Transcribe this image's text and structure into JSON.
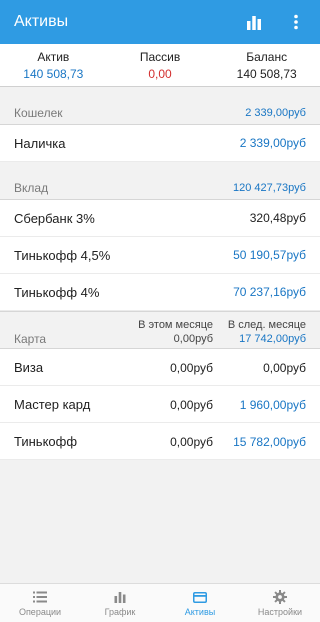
{
  "appbar": {
    "title": "Активы",
    "chart_icon": "bar-chart-icon",
    "menu_icon": "more-vertical-icon"
  },
  "summary": {
    "active": {
      "label": "Актив",
      "value": "140 508,73"
    },
    "passive": {
      "label": "Пассив",
      "value": "0,00"
    },
    "balance": {
      "label": "Баланс",
      "value": "140 508,73"
    }
  },
  "wallet": {
    "name": "Кошелек",
    "total": "2 339,00руб",
    "items": [
      {
        "name": "Наличка",
        "value": "2 339,00руб"
      }
    ]
  },
  "deposit": {
    "name": "Вклад",
    "total": "120 427,73руб",
    "items": [
      {
        "name": "Сбербанк 3%",
        "value": "320,48руб"
      },
      {
        "name": "Тинькофф 4,5%",
        "value": "50 190,57руб"
      },
      {
        "name": "Тинькофф 4%",
        "value": "70 237,16руб"
      }
    ]
  },
  "card": {
    "name": "Карта",
    "col1_label": "В этом месяце",
    "col1_total": "0,00руб",
    "col2_label": "В след. месяце",
    "col2_total": "17 742,00руб",
    "items": [
      {
        "name": "Виза",
        "v1": "0,00руб",
        "v2": "0,00руб"
      },
      {
        "name": "Мастер кард",
        "v1": "0,00руб",
        "v2": "1 960,00руб"
      },
      {
        "name": "Тинькофф",
        "v1": "0,00руб",
        "v2": "15 782,00руб"
      }
    ]
  },
  "nav": [
    {
      "label": "Операции",
      "icon": "list-icon"
    },
    {
      "label": "График",
      "icon": "bar-chart-icon"
    },
    {
      "label": "Активы",
      "icon": "credit-card-icon",
      "active": true
    },
    {
      "label": "Настройки",
      "icon": "gear-icon"
    }
  ],
  "colors": {
    "primary": "#2f9be3",
    "value_blue": "#1976c4",
    "negative_red": "#d32f2f"
  }
}
